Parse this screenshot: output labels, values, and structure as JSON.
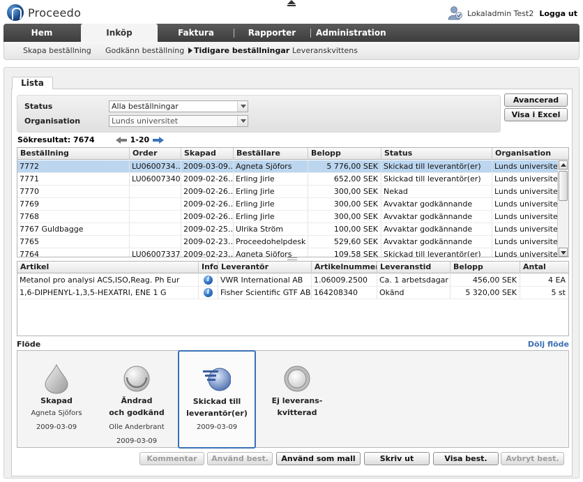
{
  "app": {
    "name": "Proceedo"
  },
  "user": {
    "name": "Lokaladmin Test2",
    "logout": "Logga ut"
  },
  "main_nav": [
    {
      "label": "Hem"
    },
    {
      "label": "Inköp"
    },
    {
      "label": "Faktura"
    },
    {
      "label": "Rapporter"
    },
    {
      "label": "Administration"
    }
  ],
  "sub_nav": [
    {
      "label": "Skapa beställning"
    },
    {
      "label": "Godkänn beställning"
    },
    {
      "label": "Tidigare beställningar"
    },
    {
      "label": "Leveranskvittens"
    }
  ],
  "tab": {
    "label": "Lista"
  },
  "filters": {
    "status_label": "Status",
    "status_value": "Alla beställningar",
    "org_label": "Organisation",
    "org_value": "Lunds universitet"
  },
  "buttons_top": {
    "advanced": "Avancerad sök",
    "excel": "Visa i Excel"
  },
  "results": {
    "label": "Sökresultat: 7674",
    "range": "1-20"
  },
  "orders": {
    "columns": [
      "Beställning",
      "Order",
      "Skapad",
      "Beställare",
      "Belopp",
      "Status",
      "Organisation"
    ],
    "rows": [
      [
        "7772",
        "LU0600734…",
        "2009-03-09…",
        "Agneta Sjöfors",
        "5 776,00 SEK",
        "Skickad till leverantör(er)",
        "Lunds universitet"
      ],
      [
        "7771",
        "LU06007340",
        "2009-02-26…",
        "Erling Jirle",
        "652,00 SEK",
        "Skickad till leverantör(er)",
        "Lunds universitet"
      ],
      [
        "7770",
        "",
        "2009-02-26…",
        "Erling Jirle",
        "300,00 SEK",
        "Nekad",
        "Lunds universitet"
      ],
      [
        "7769",
        "",
        "2009-02-26…",
        "Erling Jirle",
        "300,00 SEK",
        "Avvaktar godkännande",
        "Lunds universitet"
      ],
      [
        "7768",
        "",
        "2009-02-26…",
        "Erling Jirle",
        "300,00 SEK",
        "Avvaktar godkännande",
        "Lunds universitet"
      ],
      [
        "7767 Guldbagge",
        "",
        "2009-02-25…",
        "Ulrika Ström",
        "100,00 SEK",
        "Avvaktar godkännande",
        "Lunds universitet"
      ],
      [
        "7765",
        "",
        "2009-02-23…",
        "Proceedohelpdesk …",
        "529,60 SEK",
        "Avvaktar godkännande",
        "Lunds universitet"
      ],
      [
        "7764",
        "LU06007337",
        "2009-02-23…",
        "Agneta Sjöfors",
        "109,58 SEK",
        "Skickad till leverantör(er)",
        "Lunds universitet"
      ]
    ]
  },
  "articles": {
    "columns": [
      "Artikel",
      "Info",
      "Leverantör",
      "Artikelnummer",
      "Leveranstid",
      "Belopp",
      "Antal"
    ],
    "rows": [
      [
        "Metanol pro analysi ACS,ISO,Reag. Ph Eur",
        "i",
        "VWR International AB",
        "1.06009.2500",
        "Ca. 1 arbetsdagar",
        "456,00 SEK",
        "4 EA"
      ],
      [
        "1,6-DIPHENYL-1,3,5-HEXATRI, ENE 1 G",
        "i",
        "Fisher Scientific GTF AB",
        "164208340",
        "Okänd",
        "5 320,00 SEK",
        "5 st"
      ]
    ]
  },
  "flow": {
    "label": "Flöde",
    "hide": "Dölj flöde",
    "steps": [
      {
        "icon": "drop-icon",
        "line1": "Skapad",
        "line2": "",
        "person": "Agneta Sjöfors",
        "date": "2009-03-09"
      },
      {
        "icon": "smile-circle-icon",
        "line1": "Ändrad",
        "line2": "och godkänd",
        "person": "Olle Anderbrant",
        "date": "2009-03-09"
      },
      {
        "icon": "send-circle-icon",
        "line1": "Skickad till",
        "line2": "leverantör(er)",
        "person": "",
        "date": "2009-03-09"
      },
      {
        "icon": "ring-icon",
        "line1": "Ej leverans-",
        "line2": "kvitterad",
        "person": "",
        "date": ""
      }
    ]
  },
  "buttons_bottom": {
    "comment": "Kommentar",
    "use_order": "Använd best.",
    "use_template": "Använd som mall",
    "print": "Skriv ut",
    "show": "Visa best.",
    "cancel": "Avbryt best."
  },
  "colors": {
    "selected_row": "#bcd6ef",
    "nav_dark": "#4a4a4a",
    "link_blue": "#3c6fb4",
    "flow_current_border": "#3a70b8"
  }
}
